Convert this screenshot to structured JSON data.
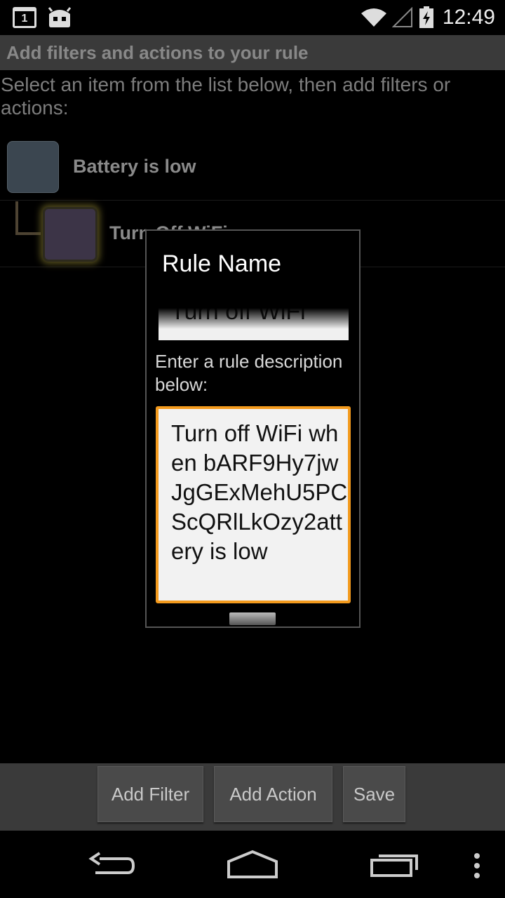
{
  "status_bar": {
    "calendar_day": "1",
    "time": "12:49",
    "icons": [
      "calendar-notification-icon",
      "android-robot-icon",
      "wifi-icon",
      "cell-signal-icon",
      "battery-charging-icon"
    ]
  },
  "header": {
    "title": "Add filters and actions to your rule",
    "instructions": "Select an item from the list below, then add filters or actions:"
  },
  "rule_list": {
    "items": [
      {
        "label": "Battery is low",
        "type": "filter",
        "color": "#3b4650"
      },
      {
        "label": "Turn Off WiFi",
        "type": "action",
        "color": "#3c3447"
      }
    ]
  },
  "dialog": {
    "title": "Rule Name",
    "name_value": "Turn off WiFi",
    "description_label": "Enter a rule description below:",
    "description_value": "Turn off WiFi when bARF9Hy7jwJgGExMehU5PCScQRlLkOzy2attery is low"
  },
  "bottom_bar": {
    "add_filter": "Add Filter",
    "add_action": "Add Action",
    "save": "Save"
  },
  "nav_bar": {
    "icons": [
      "back-icon",
      "home-icon",
      "recents-icon",
      "overflow-menu-icon"
    ]
  },
  "colors": {
    "accent_focus": "#f39a1d",
    "title_bar": "#3a3a3a"
  }
}
